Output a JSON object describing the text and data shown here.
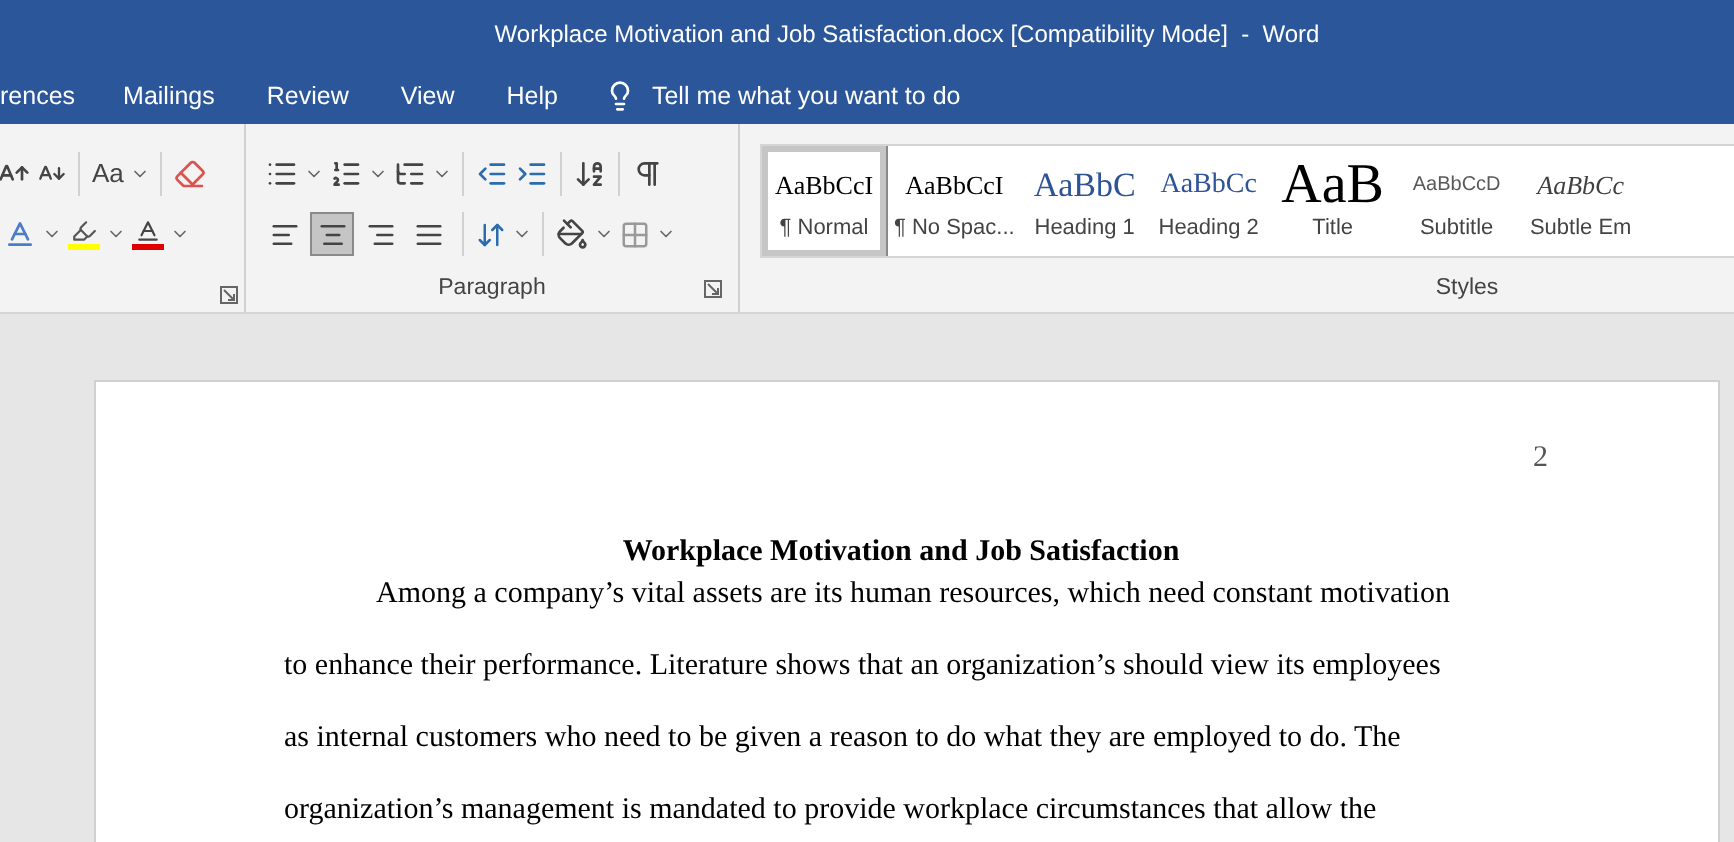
{
  "window": {
    "title": "Workplace Motivation and Job Satisfaction.docx [Compatibility Mode]  -  Word"
  },
  "tabs": [
    {
      "label": "rences",
      "selected": false
    },
    {
      "label": "Mailings",
      "selected": false
    },
    {
      "label": "Review",
      "selected": false
    },
    {
      "label": "View",
      "selected": false
    },
    {
      "label": "Help",
      "selected": false
    }
  ],
  "tell_me": {
    "placeholder": "Tell me what you want to do"
  },
  "font_group": {
    "change_case": "Aa"
  },
  "paragraph_group": {
    "label": "Paragraph",
    "alignments": [
      {
        "kind": "left",
        "selected": false
      },
      {
        "kind": "center",
        "selected": true
      },
      {
        "kind": "right",
        "selected": false
      },
      {
        "kind": "justify",
        "selected": false
      }
    ]
  },
  "styles_group": {
    "label": "Styles",
    "items": [
      {
        "kind": "normal",
        "preview": "AaBbCcI",
        "name": "¶ Normal",
        "selected": true
      },
      {
        "kind": "no-spacing",
        "preview": "AaBbCcI",
        "name": "¶ No Spac...",
        "selected": false
      },
      {
        "kind": "heading1",
        "preview": "AaBbC",
        "name": "Heading 1",
        "selected": false
      },
      {
        "kind": "heading2",
        "preview": "AaBbCc",
        "name": "Heading 2",
        "selected": false
      },
      {
        "kind": "title",
        "preview": "AaB",
        "name": "Title",
        "selected": false
      },
      {
        "kind": "subtitle",
        "preview": "AaBbCcD",
        "name": "Subtitle",
        "selected": false
      },
      {
        "kind": "subtle-emphasis",
        "preview": "AaBbCc",
        "name": "Subtle Em",
        "selected": false
      }
    ]
  },
  "document": {
    "page_number": "2",
    "title": "Workplace Motivation and Job Satisfaction",
    "body_lines": [
      "Among a company’s vital assets are its human resources, which need constant motivation",
      "to enhance their performance. Literature shows that an organization’s should view its employees",
      "as internal customers who need to be given a reason to do what they are employed to do. The",
      "organization’s management is mandated to provide workplace circumstances that allow the"
    ]
  }
}
